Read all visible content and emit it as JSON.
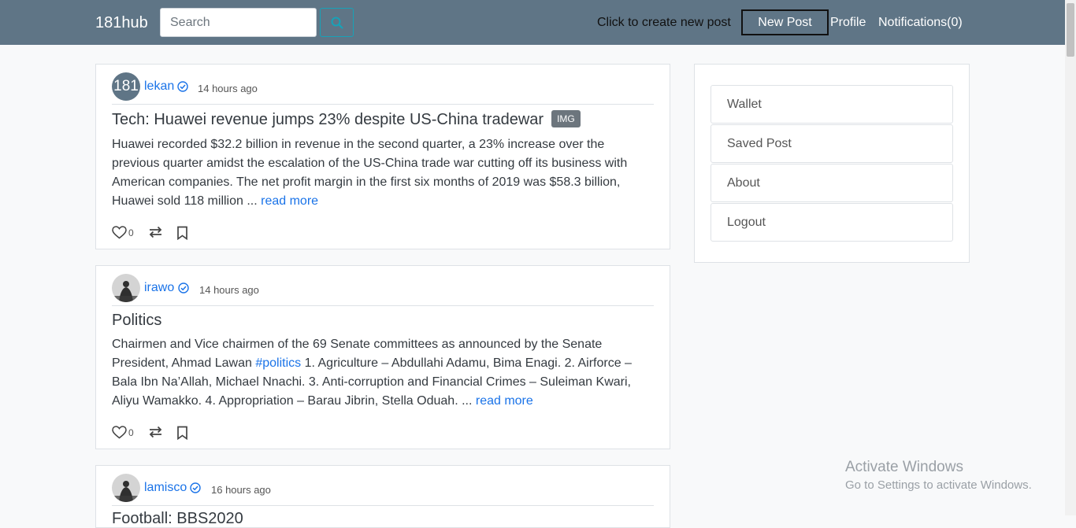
{
  "navbar": {
    "brand": "181hub",
    "search_placeholder": "Search",
    "hint": "Click to create new post",
    "new_post": "New Post",
    "profile": "Profile",
    "notifications": "Notifications(0)"
  },
  "posts": [
    {
      "avatar_text": "181",
      "author": "lekan",
      "time": "14 hours ago",
      "title": "Tech: Huawei revenue jumps 23% despite US-China tradewar",
      "badge": "IMG",
      "body": "Huawei recorded $32.2 billion in revenue in the second quarter, a 23% increase over the previous quarter amidst the escalation of the US-China trade war cutting off its business with American companies. The net profit margin in the first six months of 2019 was $58.3 billion, Huawei sold 118 million ... ",
      "read_more": "read more",
      "likes": "0"
    },
    {
      "author": "irawo",
      "time": "14 hours ago",
      "title": "Politics",
      "body_before": "Chairmen and Vice chairmen of the 69 Senate committees as announced by the Senate President, Ahmad Lawan ",
      "hashtag": "#politics",
      "body_after": " 1. Agriculture – Abdullahi Adamu, Bima Enagi. 2. Airforce – Bala Ibn Na’Allah, Michael Nnachi. 3. Anti-corruption and Financial Crimes – Suleiman Kwari, Aliyu Wamakko. 4. Appropriation – Barau Jibrin, Stella Oduah. ... ",
      "read_more": "read more",
      "likes": "0"
    },
    {
      "author": "lamisco",
      "time": "16 hours ago",
      "title": "Football: BBS2020"
    }
  ],
  "sidebar": {
    "items": [
      "Wallet",
      "Saved Post",
      "About",
      "Logout"
    ]
  },
  "watermark": {
    "title": "Activate Windows",
    "subtitle": "Go to Settings to activate Windows."
  },
  "colors": {
    "navbar": "#5f7586",
    "link": "#1a73e8",
    "badge": "#6c757d"
  }
}
